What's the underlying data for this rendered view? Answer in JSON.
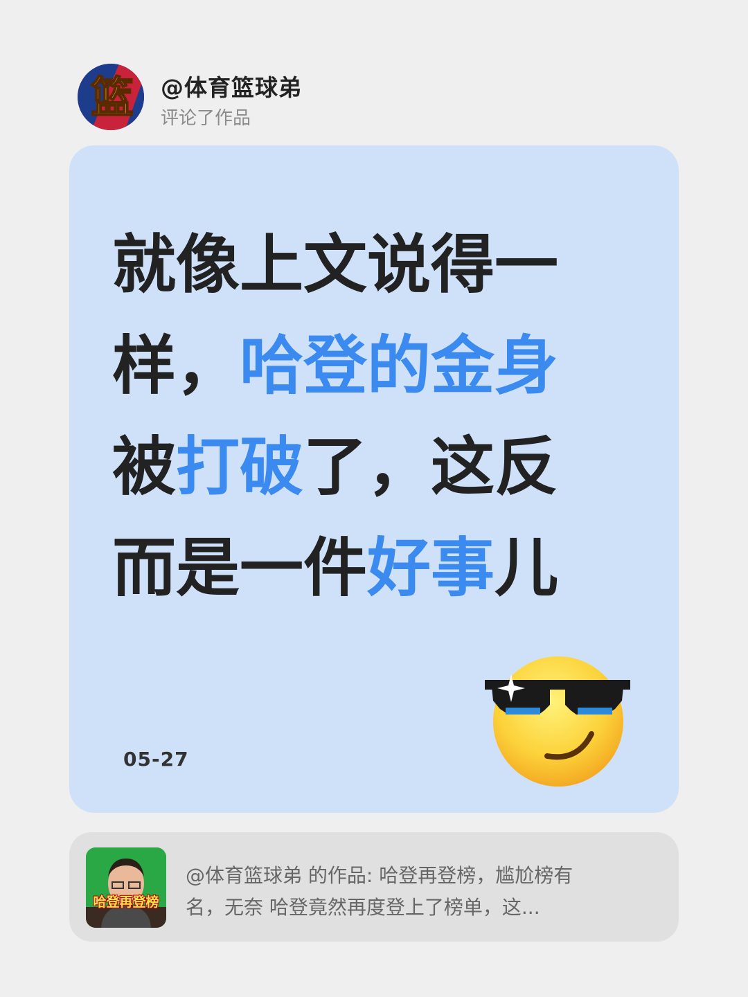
{
  "header": {
    "username": "@体育篮球弟",
    "action": "评论了作品",
    "avatar_icon": "basketball-logo-icon",
    "avatar_text": "篮"
  },
  "comment": {
    "lines": [
      [
        {
          "text": "就像上文说得一",
          "highlight": false
        }
      ],
      [
        {
          "text": "样，",
          "highlight": false
        },
        {
          "text": "哈登的金身",
          "highlight": true
        }
      ],
      [
        {
          "text": "被",
          "highlight": false
        },
        {
          "text": "打破",
          "highlight": true
        },
        {
          "text": "了，这反",
          "highlight": false
        }
      ],
      [
        {
          "text": "而是一件",
          "highlight": false
        },
        {
          "text": "好事",
          "highlight": true
        },
        {
          "text": "儿",
          "highlight": false
        }
      ]
    ],
    "date": "05-27",
    "emoji": "smiling-face-with-sunglasses-icon",
    "colors": {
      "text": "#222222",
      "highlight": "#3a8af0",
      "background": "#cfe1f8"
    }
  },
  "reference": {
    "thumbnail_caption": "哈登再登榜",
    "thumbnail_icon": "video-thumbnail-icon",
    "line1": "@体育篮球弟 的作品: 哈登再登榜，尴尬榜有",
    "line2": "名，无奈 哈登竟然再度登上了榜单，这..."
  }
}
